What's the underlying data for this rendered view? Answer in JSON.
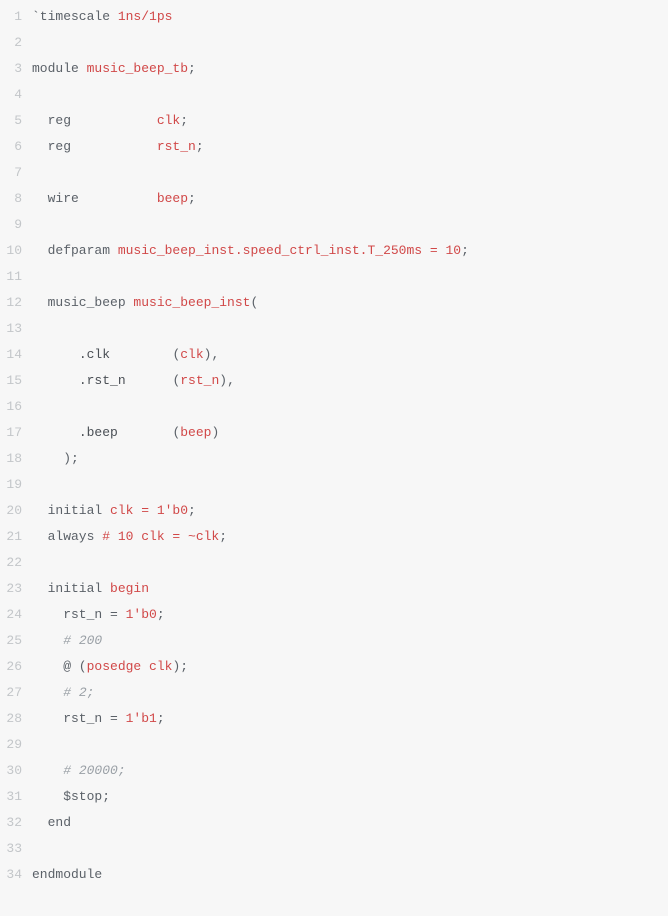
{
  "lines": [
    {
      "n": 1,
      "segments": [
        {
          "cls": "pl",
          "t": "`timescale "
        },
        {
          "cls": "red",
          "t": "1ns/1ps"
        }
      ]
    },
    {
      "n": 2,
      "segments": [
        {
          "cls": "pl",
          "t": ""
        }
      ]
    },
    {
      "n": 3,
      "segments": [
        {
          "cls": "pl",
          "t": "module "
        },
        {
          "cls": "red",
          "t": "music_beep_tb"
        },
        {
          "cls": "pl",
          "t": ";"
        }
      ]
    },
    {
      "n": 4,
      "segments": [
        {
          "cls": "pl",
          "t": ""
        }
      ]
    },
    {
      "n": 5,
      "segments": [
        {
          "cls": "pl",
          "t": "  reg           "
        },
        {
          "cls": "red",
          "t": "clk"
        },
        {
          "cls": "pl",
          "t": ";"
        }
      ]
    },
    {
      "n": 6,
      "segments": [
        {
          "cls": "pl",
          "t": "  reg           "
        },
        {
          "cls": "red",
          "t": "rst_n"
        },
        {
          "cls": "pl",
          "t": ";"
        }
      ]
    },
    {
      "n": 7,
      "segments": [
        {
          "cls": "pl",
          "t": ""
        }
      ]
    },
    {
      "n": 8,
      "segments": [
        {
          "cls": "pl",
          "t": "  wire          "
        },
        {
          "cls": "red",
          "t": "beep"
        },
        {
          "cls": "pl",
          "t": ";"
        }
      ]
    },
    {
      "n": 9,
      "segments": [
        {
          "cls": "pl",
          "t": ""
        }
      ]
    },
    {
      "n": 10,
      "segments": [
        {
          "cls": "pl",
          "t": "  defparam "
        },
        {
          "cls": "red",
          "t": "music_beep_inst.speed_ctrl_inst.T_250ms = 10"
        },
        {
          "cls": "pl",
          "t": ";"
        }
      ]
    },
    {
      "n": 11,
      "segments": [
        {
          "cls": "pl",
          "t": ""
        }
      ]
    },
    {
      "n": 12,
      "segments": [
        {
          "cls": "pl",
          "t": "  music_beep "
        },
        {
          "cls": "red",
          "t": "music_beep_inst"
        },
        {
          "cls": "pl",
          "t": "("
        }
      ]
    },
    {
      "n": 13,
      "segments": [
        {
          "cls": "pl",
          "t": ""
        }
      ]
    },
    {
      "n": 14,
      "segments": [
        {
          "cls": "pl",
          "t": "      "
        },
        {
          "cls": "darkpl",
          "t": ".clk        "
        },
        {
          "cls": "pl",
          "t": "("
        },
        {
          "cls": "red",
          "t": "clk"
        },
        {
          "cls": "pl",
          "t": "),"
        }
      ]
    },
    {
      "n": 15,
      "segments": [
        {
          "cls": "pl",
          "t": "      "
        },
        {
          "cls": "darkpl",
          "t": ".rst_n      "
        },
        {
          "cls": "pl",
          "t": "("
        },
        {
          "cls": "red",
          "t": "rst_n"
        },
        {
          "cls": "pl",
          "t": "),"
        }
      ]
    },
    {
      "n": 16,
      "segments": [
        {
          "cls": "pl",
          "t": ""
        }
      ]
    },
    {
      "n": 17,
      "segments": [
        {
          "cls": "pl",
          "t": "      "
        },
        {
          "cls": "darkpl",
          "t": ".beep       "
        },
        {
          "cls": "pl",
          "t": "("
        },
        {
          "cls": "red",
          "t": "beep"
        },
        {
          "cls": "pl",
          "t": ")"
        }
      ]
    },
    {
      "n": 18,
      "segments": [
        {
          "cls": "pl",
          "t": "    );"
        }
      ]
    },
    {
      "n": 19,
      "segments": [
        {
          "cls": "pl",
          "t": ""
        }
      ]
    },
    {
      "n": 20,
      "segments": [
        {
          "cls": "pl",
          "t": "  initial "
        },
        {
          "cls": "red",
          "t": "clk = 1'b0"
        },
        {
          "cls": "pl",
          "t": ";"
        }
      ]
    },
    {
      "n": 21,
      "segments": [
        {
          "cls": "pl",
          "t": "  always "
        },
        {
          "cls": "red",
          "t": "# 10 clk = ~clk"
        },
        {
          "cls": "pl",
          "t": ";"
        }
      ]
    },
    {
      "n": 22,
      "segments": [
        {
          "cls": "pl",
          "t": ""
        }
      ]
    },
    {
      "n": 23,
      "segments": [
        {
          "cls": "pl",
          "t": "  initial "
        },
        {
          "cls": "red",
          "t": "begin"
        }
      ]
    },
    {
      "n": 24,
      "segments": [
        {
          "cls": "pl",
          "t": "    rst_n = "
        },
        {
          "cls": "red",
          "t": "1'b0"
        },
        {
          "cls": "pl",
          "t": ";"
        }
      ]
    },
    {
      "n": 25,
      "segments": [
        {
          "cls": "pl",
          "t": "    "
        },
        {
          "cls": "cmt",
          "t": "# 200"
        }
      ]
    },
    {
      "n": 26,
      "segments": [
        {
          "cls": "pl",
          "t": "    @ ("
        },
        {
          "cls": "red",
          "t": "posedge clk"
        },
        {
          "cls": "pl",
          "t": ");"
        }
      ]
    },
    {
      "n": 27,
      "segments": [
        {
          "cls": "pl",
          "t": "    "
        },
        {
          "cls": "cmt",
          "t": "# 2;"
        }
      ]
    },
    {
      "n": 28,
      "segments": [
        {
          "cls": "pl",
          "t": "    rst_n = "
        },
        {
          "cls": "red",
          "t": "1'b1"
        },
        {
          "cls": "pl",
          "t": ";"
        }
      ]
    },
    {
      "n": 29,
      "segments": [
        {
          "cls": "pl",
          "t": ""
        }
      ]
    },
    {
      "n": 30,
      "segments": [
        {
          "cls": "pl",
          "t": "    "
        },
        {
          "cls": "cmt",
          "t": "# 20000;"
        }
      ]
    },
    {
      "n": 31,
      "segments": [
        {
          "cls": "pl",
          "t": "    $stop;"
        }
      ]
    },
    {
      "n": 32,
      "segments": [
        {
          "cls": "pl",
          "t": "  end"
        }
      ]
    },
    {
      "n": 33,
      "segments": [
        {
          "cls": "pl",
          "t": ""
        }
      ]
    },
    {
      "n": 34,
      "segments": [
        {
          "cls": "pl",
          "t": "endmodule"
        }
      ]
    }
  ]
}
